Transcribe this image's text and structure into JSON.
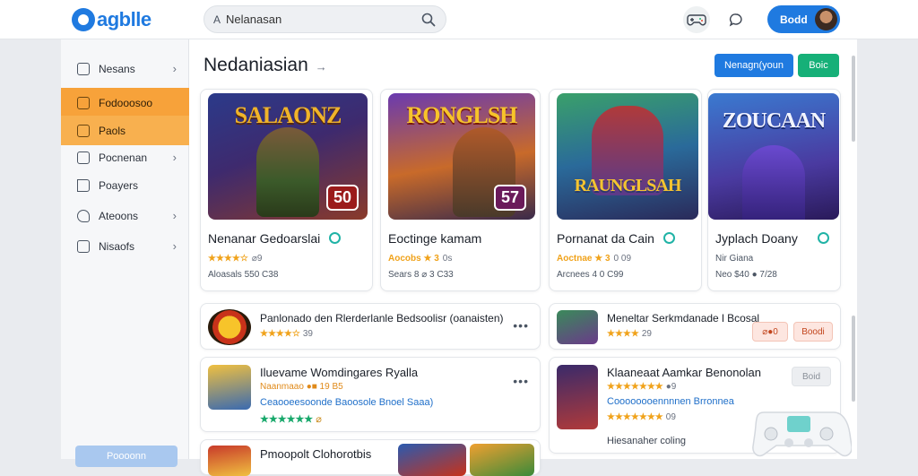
{
  "app": {
    "logo_text": "agblle",
    "brand_color": "#1f7ae0"
  },
  "search": {
    "prefix": "A",
    "value": "Nelanasan"
  },
  "user": {
    "label": "Bodd"
  },
  "sidebar": {
    "items": [
      {
        "label": "Nesans",
        "icon": "grid-icon",
        "active": false
      },
      {
        "label": "Fodooosoo",
        "icon": "bag-icon",
        "active": true
      },
      {
        "label": "Paols",
        "icon": "box-icon",
        "active": true
      },
      {
        "label": "Pocnenan",
        "icon": "card-icon",
        "active": false
      },
      {
        "label": "Poayers",
        "icon": "flag-icon",
        "active": false
      },
      {
        "label": "Ateoons",
        "icon": "heart-icon",
        "active": false
      },
      {
        "label": "Nisaofs",
        "icon": "doc-icon",
        "active": false
      }
    ],
    "bottom_button": "Poooonn"
  },
  "main": {
    "title": "Nedaniasian",
    "title_arrow": "→",
    "primary_button": "Nenagn(youn",
    "secondary_button": "Boic"
  },
  "cards": [
    {
      "art_title": "SALAONZ",
      "badge": "50",
      "name": "Nenanar Gedoarslai",
      "stars": "★★★★☆",
      "rating_text": "⌀9",
      "meta": "Aloasals 550 C38"
    },
    {
      "art_title": "RONGLSH",
      "badge": "57",
      "name": "Eoctinge kamam",
      "stars": "Aocobs ★ 3",
      "rating_text": "0s",
      "meta": "Sears 8 ⌀ 3 C33"
    },
    {
      "art_title": "RAUNGLSAH",
      "badge": "",
      "name": "Pornanat da Cain",
      "stars": "Aoctnae ★ 3",
      "rating_text": "0 09",
      "meta": "Arcnees 4 0 C99"
    },
    {
      "art_title": "ZOUCAAN",
      "badge": "",
      "name": "Jyplach Doany",
      "stars": "",
      "rating_text": "",
      "meta": "Nir Giana",
      "meta2": "Neo $40 ● 7/28"
    }
  ],
  "rows": [
    {
      "title": "Panlonado den Rlerderlanle Bedsoolisr (oanaisten)",
      "stars": "★★★★☆",
      "rating": "39"
    },
    {
      "title": "Meneltar Serkmdanade l Bcosal",
      "stars": "★★★★",
      "rating": "29",
      "btn1": "⌀●0",
      "btn2": "Boodi"
    },
    {
      "title": "Iluevame Womdingares Ryalla",
      "sub1": "Naanmaao ●■ 19 B5",
      "sub2": "Ceaooeesoonde Baoosole Bnoel Saaa)",
      "green_stars": "★★★★★★",
      "green_rating": "⌀"
    },
    {
      "title": "Klaaneaat Aamkar Benonolan",
      "stars": "★★★★★★★",
      "rating": "●9",
      "sub": "Coooooooennnnen Brronnea",
      "stars2": "★★★★★★★",
      "rating2": "09",
      "footer": "Hiesanaher coling",
      "btn": "Boid"
    },
    {
      "title": "Pmoopolt Clohorotbis"
    }
  ],
  "colors": {
    "accent_orange": "#f7a23a",
    "accent_green": "#16b078",
    "star": "#f0a21a"
  }
}
